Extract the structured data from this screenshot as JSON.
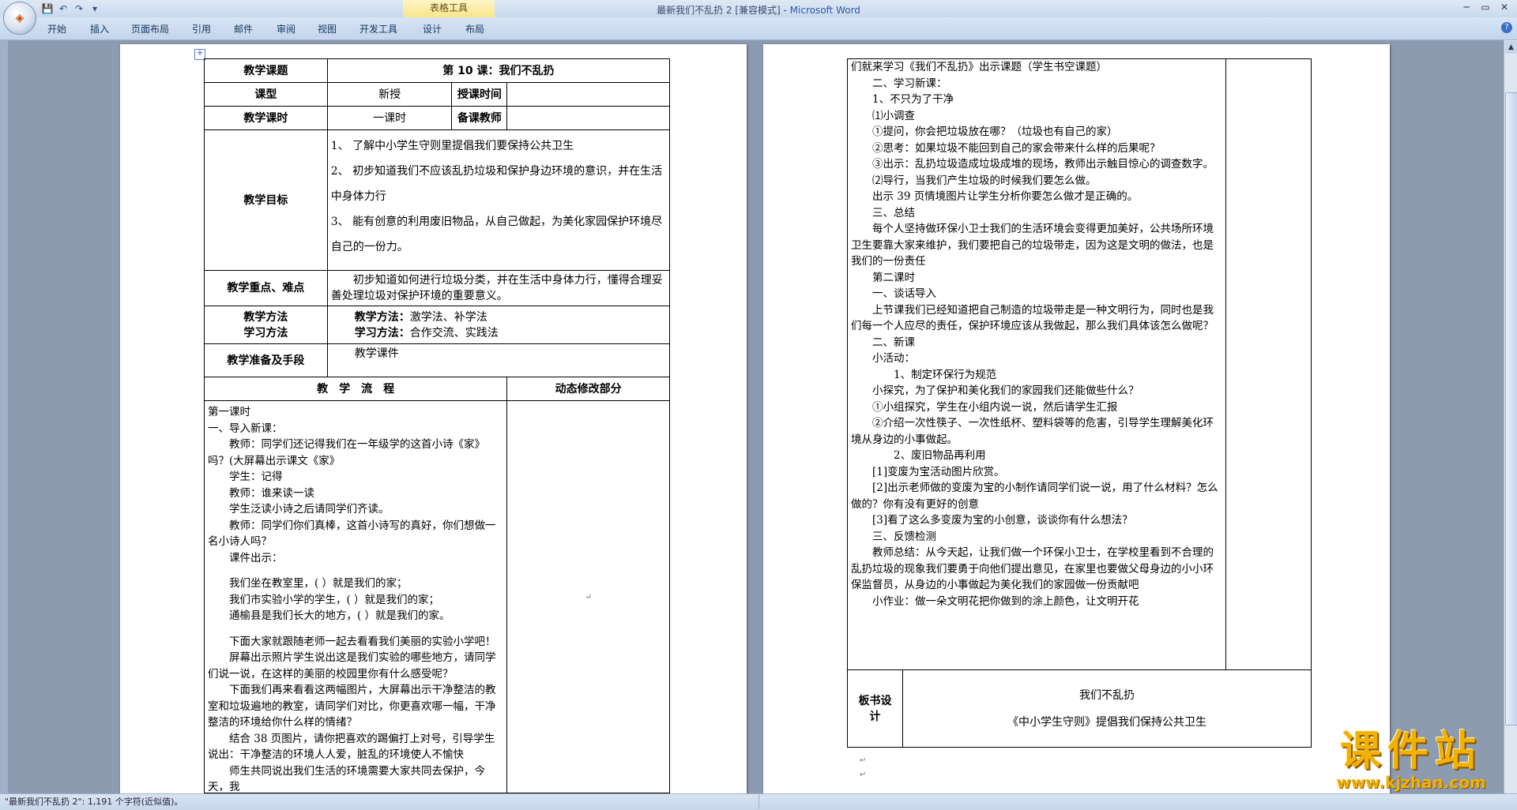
{
  "window": {
    "doc_title": "最新我们不乱扔 2 [兼容模式] - ",
    "app_name": "Microsoft Word",
    "context_tab": "表格工具"
  },
  "ribbon": {
    "tabs": [
      "开始",
      "插入",
      "页面布局",
      "引用",
      "邮件",
      "审阅",
      "视图",
      "开发工具",
      "设计",
      "布局"
    ]
  },
  "qat": {
    "save": "💾",
    "undo": "↶",
    "redo": "↷",
    "more": "▾"
  },
  "window_controls": {
    "minimize": "─",
    "maximize": "▭",
    "close": "✕"
  },
  "help": "?",
  "status": {
    "text": "\"最新我们不乱扔 2\": 1,191 个字符(近似值)。"
  },
  "para_mark": "↵",
  "table": {
    "topic_label": "教学课题",
    "topic_value": "第 10 课：我们不乱扔",
    "type_label": "课型",
    "type_value": "新授",
    "time_label": "授课时间",
    "hours_label": "教学课时",
    "hours_value": "一课时",
    "teacher_label": "备课教师",
    "goals_label": "教学目标",
    "goals": [
      "1、 了解中小学生守则里提倡我们要保持公共卫生",
      "2、 初步知道我们不应该乱扔垃圾和保护身边环境的意识，并在生活中身体力行",
      "3、 能有创意的利用废旧物品，从自己做起，为美化家园保护环境尽自己的一份力。"
    ],
    "key_label": "教学重点、难点",
    "key_value": "初步知道如何进行垃圾分类，并在生活中身体力行，懂得合理妥善处理垃圾对保护环境的重要意义。",
    "method_label_1": "教学方法",
    "method_label_2": "学习方法",
    "method_prefix_1": "教学方法：",
    "method_value_1": "激学法、补学法",
    "method_prefix_2": "学习方法：",
    "method_value_2": "合作交流、实践法",
    "prep_label": "教学准备及手段",
    "prep_value": "教学课件",
    "flow_header": "教　学　流　程",
    "modify_header": "动态修改部分"
  },
  "flow_left": [
    "第一课时",
    "一、导入新课：",
    "教师：同学们还记得我们在一年级学的这首小诗《家》吗？(大屏幕出示课文《家》",
    "学生：记得",
    "教师：谁来读一读",
    "学生泛读小诗之后请同学们齐读。",
    "教师：同学们你们真棒，这首小诗写的真好，你们想做一名小诗人吗？",
    "课件出示：",
    "",
    "我们坐在教室里，( ）就是我们的家；",
    "我们市实验小学的学生，( ）就是我们的家；",
    "通榆县是我们长大的地方，( ）就是我们的家。",
    "",
    "下面大家就跟随老师一起去看看我们美丽的实验小学吧！",
    "屏幕出示照片学生说出这是我们实验的哪些地方，请同学们说一说，在这样的美丽的校园里你有什么感受呢？",
    "下面我们再来看看这两幅图片，大屏幕出示干净整洁的教室和垃圾遍地的教室，请同学们对比，你更喜欢哪一幅，干净整洁的环境给你什么样的情绪？",
    "结合 38 页图片，请你把喜欢的踢偏打上对号，引导学生说出：干净整洁的环境人人爱，脏乱的环境使人不愉快",
    "师生共同说出我们生活的环境需要大家共同去保护，今天，我"
  ],
  "flow_right": [
    "们就来学习《我们不乱扔》出示课题（学生书空课题）",
    "二、学习新课：",
    "1、不只为了干净",
    "⑴小调查",
    "①提问，你会把垃圾放在哪？（垃圾也有自己的家）",
    "②思考：如果垃圾不能回到自己的家会带来什么样的后果呢？",
    "③出示：乱扔垃圾造成垃圾成堆的现场，教师出示触目惊心的调查数字。",
    "⑵导行，当我们产生垃圾的时候我们要怎么做。",
    "出示 39 页情境图片让学生分析你要怎么做才是正确的。",
    "三、总结",
    "每个人坚持做环保小卫士我们的生活环境会变得更加美好，公共场所环境卫生要靠大家来维护，我们要把自己的垃圾带走，因为这是文明的做法，也是我们的一份责任",
    "第二课时",
    "一、谈话导入",
    "上节课我们已经知道把自己制造的垃圾带走是一种文明行为，同时也是我们每一个人应尽的责任，保护环境应该从我做起，那么我们具体该怎么做呢？",
    "二、新课",
    "小活动：",
    "1、制定环保行为规范",
    "小探究，为了保护和美化我们的家园我们还能做些什么？",
    "①小组探究，学生在小组内说一说，然后请学生汇报",
    "②介绍一次性筷子、一次性纸杯、塑料袋等的危害，引导学生理解美化环境从身边的小事做起。",
    "2、废旧物品再利用",
    "[1]变废为宝活动图片欣赏。",
    "[2]出示老师做的变废为宝的小制作请同学们说一说，用了什么材料？怎么做的？你有没有更好的创意",
    "[3]看了这么多变废为宝的小创意，谈谈你有什么想法？",
    "三、反馈检测",
    "教师总结：从今天起，让我们做一个环保小卫士，在学校里看到不合理的乱扔垃圾的现象我们要勇于向他们提出意见，在家里也要做父母身边的小小环保监督员，从身边的小事做起为美化我们的家园做一份贡献吧",
    "小作业：做一朵文明花把你做到的涂上颜色，让文明开花"
  ],
  "board": {
    "label": "板书设计",
    "line1": "我们不乱扔",
    "line2": "《中小学生守则》提倡我们保持公共卫生"
  },
  "logo": {
    "text": "课件站",
    "url": "www.kjzhan.com"
  }
}
